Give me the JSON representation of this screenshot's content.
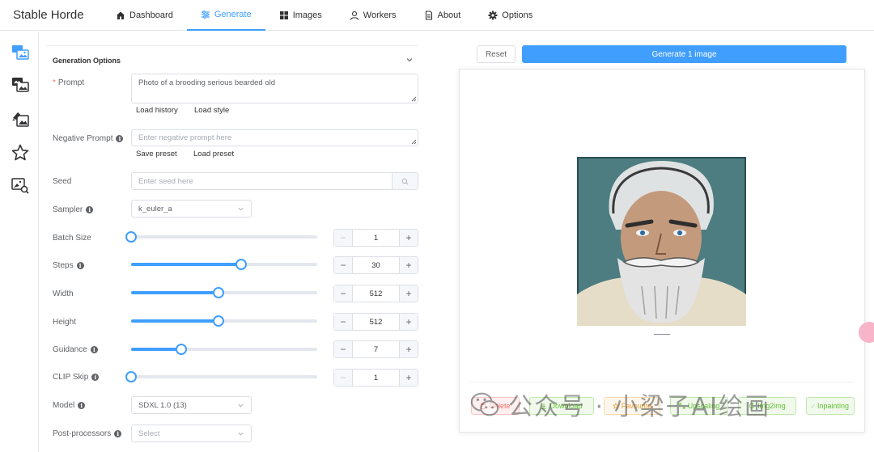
{
  "app": {
    "brand": "Stable Horde"
  },
  "nav": [
    {
      "label": "Dashboard",
      "icon": "home-icon",
      "active": false
    },
    {
      "label": "Generate",
      "icon": "sliders-icon",
      "active": true
    },
    {
      "label": "Images",
      "icon": "grid-icon",
      "active": false
    },
    {
      "label": "Workers",
      "icon": "user-icon",
      "active": false
    },
    {
      "label": "About",
      "icon": "document-icon",
      "active": false
    },
    {
      "label": "Options",
      "icon": "gear-icon",
      "active": false
    }
  ],
  "sidebar": [
    "text-to-image-icon",
    "image-to-image-icon",
    "inpainting-icon",
    "favourite-star-icon",
    "image-search-icon"
  ],
  "form": {
    "section_title": "Generation Options",
    "prompt": {
      "label": "Prompt",
      "value": "Photo of a brooding serious bearded old"
    },
    "prompt_links": {
      "load_history": "Load history",
      "load_style": "Load style"
    },
    "negative_prompt": {
      "label": "Negative Prompt",
      "placeholder": "Enter negative prompt here"
    },
    "preset_links": {
      "save_preset": "Save preset",
      "load_preset": "Load preset"
    },
    "seed": {
      "label": "Seed",
      "placeholder": "Enter seed here"
    },
    "sampler": {
      "label": "Sampler",
      "value": "k_euler_a"
    },
    "batch_size": {
      "label": "Batch Size",
      "value": "1",
      "level": 0
    },
    "steps": {
      "label": "Steps",
      "value": "30",
      "level": 0.59
    },
    "width": {
      "label": "Width",
      "value": "512",
      "level": 0.47
    },
    "height": {
      "label": "Height",
      "value": "512",
      "level": 0.47
    },
    "guidance": {
      "label": "Guidance",
      "value": "7",
      "level": 0.27
    },
    "clip_skip": {
      "label": "CLIP Skip",
      "value": "1",
      "level": 0
    },
    "model": {
      "label": "Model",
      "value": "SDXL 1.0 (13)"
    },
    "post_processors": {
      "label": "Post-processors",
      "placeholder": "Select"
    }
  },
  "output": {
    "reset_label": "Reset",
    "generate_label": "Generate 1 image",
    "actions": {
      "delete": "Delete",
      "download": "Download",
      "favourite": "Favourite",
      "upscaling": "Upscaling",
      "img2img": "Img2img",
      "inpainting": "Inpainting"
    }
  },
  "watermark": "公众号 · 小梁子AI绘画",
  "colors": {
    "accent": "#409eff",
    "danger": "#f56c6c",
    "success": "#67c23a",
    "warning": "#e6a23c"
  }
}
